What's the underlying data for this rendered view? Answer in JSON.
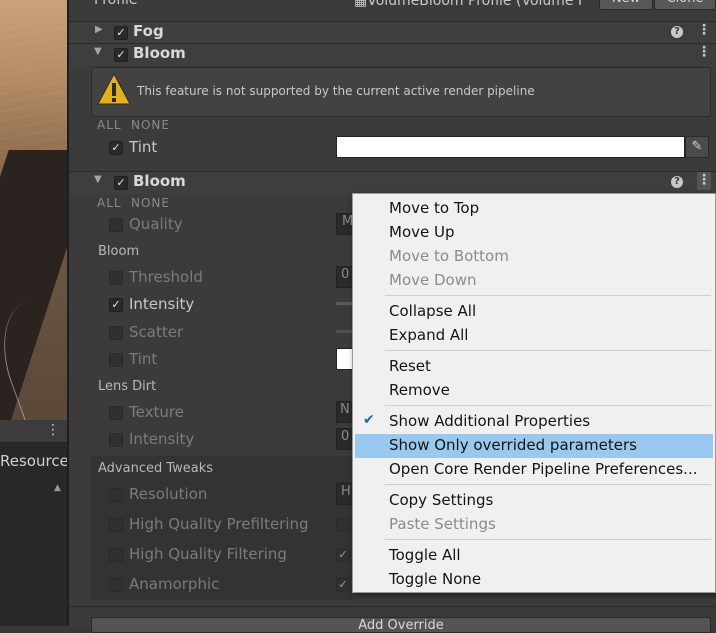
{
  "left_panel": {
    "label": "Resource"
  },
  "inspector": {
    "profile": {
      "label": "Profile",
      "value": "VolumeBloom Profile (Volume I",
      "new_button": "New",
      "clone_button": "Clone"
    },
    "fog": {
      "title": "Fog",
      "enabled": true
    },
    "bloom1": {
      "title": "Bloom",
      "enabled": true,
      "warning": "This feature is not supported by the current active render pipeline",
      "all_label": "ALL",
      "none_label": "NONE",
      "tint_label": "Tint"
    },
    "bloom2": {
      "title": "Bloom",
      "enabled": true,
      "all_label": "ALL",
      "none_label": "NONE",
      "quality_label": "Quality",
      "quality_value": "M",
      "section_bloom": "Bloom",
      "threshold_label": "Threshold",
      "threshold_value": "0",
      "intensity_label": "Intensity",
      "scatter_label": "Scatter",
      "tint_label": "Tint",
      "section_lens_dirt": "Lens Dirt",
      "texture_label": "Texture",
      "texture_value": "N",
      "lens_intensity_label": "Intensity",
      "lens_intensity_value": "0",
      "section_advanced": "Advanced Tweaks",
      "resolution_label": "Resolution",
      "resolution_value": "H",
      "hq_prefiltering_label": "High Quality Prefiltering",
      "hq_filtering_label": "High Quality Filtering",
      "anamorphic_label": "Anamorphic"
    },
    "add_override": "Add Override"
  },
  "context_menu": {
    "items": [
      {
        "label": "Move to Top"
      },
      {
        "label": "Move Up"
      },
      {
        "label": "Move to Bottom"
      },
      {
        "label": "Move Down"
      },
      {
        "label": "Collapse All"
      },
      {
        "label": "Expand All"
      },
      {
        "label": "Reset"
      },
      {
        "label": "Remove"
      },
      {
        "label": "Show Additional Properties"
      },
      {
        "label": "Show Only overrided parameters"
      },
      {
        "label": "Open Core Render Pipeline Preferences..."
      },
      {
        "label": "Copy Settings"
      },
      {
        "label": "Paste Settings"
      },
      {
        "label": "Toggle All"
      },
      {
        "label": "Toggle None"
      }
    ]
  },
  "colors": {
    "menu_highlight": "#99c9ef",
    "warning_icon": "#e3b21b",
    "check_accent": "#1a64d8"
  }
}
